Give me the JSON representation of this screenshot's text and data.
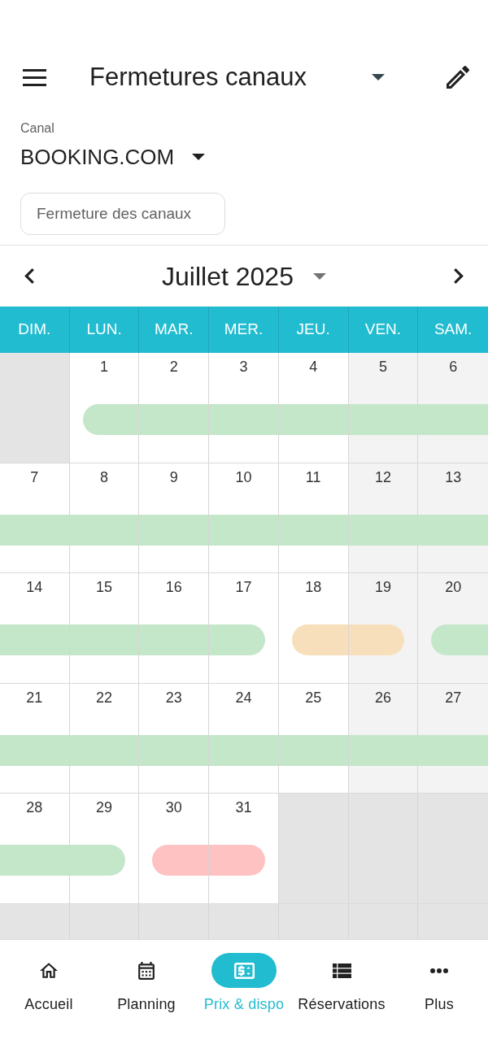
{
  "header": {
    "title": "Fermetures canaux"
  },
  "channel": {
    "label": "Canal",
    "value": "BOOKING.COM"
  },
  "filter_chip": {
    "label": "Fermeture des canaux"
  },
  "month_nav": {
    "title": "Juillet 2025"
  },
  "calendar": {
    "weekdays": [
      "DIM.",
      "LUN.",
      "MAR.",
      "MER.",
      "JEU.",
      "VEN.",
      "SAM."
    ],
    "weeks": [
      {
        "days": [
          {
            "kind": "empty"
          },
          {
            "kind": "day",
            "label": "1",
            "weekend": false,
            "closure": {
              "color": "#c5e7c9",
              "starts": true,
              "ends": false
            }
          },
          {
            "kind": "day",
            "label": "2",
            "weekend": false,
            "closure": {
              "color": "#c5e7c9",
              "starts": false,
              "ends": false
            }
          },
          {
            "kind": "day",
            "label": "3",
            "weekend": false,
            "closure": {
              "color": "#c5e7c9",
              "starts": false,
              "ends": false
            }
          },
          {
            "kind": "day",
            "label": "4",
            "weekend": false,
            "closure": {
              "color": "#c5e7c9",
              "starts": false,
              "ends": false
            }
          },
          {
            "kind": "day",
            "label": "5",
            "weekend": true,
            "closure": {
              "color": "#c5e7c9",
              "starts": false,
              "ends": false
            }
          },
          {
            "kind": "day",
            "label": "6",
            "weekend": true,
            "closure": {
              "color": "#c5e7c9",
              "starts": false,
              "ends": false
            }
          }
        ]
      },
      {
        "days": [
          {
            "kind": "day",
            "label": "7",
            "weekend": false,
            "closure": {
              "color": "#c5e7c9",
              "starts": false,
              "ends": false
            }
          },
          {
            "kind": "day",
            "label": "8",
            "weekend": false,
            "closure": {
              "color": "#c5e7c9",
              "starts": false,
              "ends": false
            }
          },
          {
            "kind": "day",
            "label": "9",
            "weekend": false,
            "closure": {
              "color": "#c5e7c9",
              "starts": false,
              "ends": false
            }
          },
          {
            "kind": "day",
            "label": "10",
            "weekend": false,
            "closure": {
              "color": "#c5e7c9",
              "starts": false,
              "ends": false
            }
          },
          {
            "kind": "day",
            "label": "11",
            "weekend": false,
            "closure": {
              "color": "#c5e7c9",
              "starts": false,
              "ends": false
            }
          },
          {
            "kind": "day",
            "label": "12",
            "weekend": true,
            "closure": {
              "color": "#c5e7c9",
              "starts": false,
              "ends": false
            }
          },
          {
            "kind": "day",
            "label": "13",
            "weekend": true,
            "closure": {
              "color": "#c5e7c9",
              "starts": false,
              "ends": false
            }
          }
        ]
      },
      {
        "days": [
          {
            "kind": "day",
            "label": "14",
            "weekend": false,
            "closure": {
              "color": "#c5e7c9",
              "starts": false,
              "ends": false
            }
          },
          {
            "kind": "day",
            "label": "15",
            "weekend": false,
            "closure": {
              "color": "#c5e7c9",
              "starts": false,
              "ends": false
            }
          },
          {
            "kind": "day",
            "label": "16",
            "weekend": false,
            "closure": {
              "color": "#c5e7c9",
              "starts": false,
              "ends": false
            }
          },
          {
            "kind": "day",
            "label": "17",
            "weekend": false,
            "closure": {
              "color": "#c5e7c9",
              "starts": false,
              "ends": true
            }
          },
          {
            "kind": "day",
            "label": "18",
            "weekend": false,
            "closure": {
              "color": "#f8dfbc",
              "starts": true,
              "ends": false
            }
          },
          {
            "kind": "day",
            "label": "19",
            "weekend": true,
            "closure": {
              "color": "#f8dfbc",
              "starts": false,
              "ends": true
            }
          },
          {
            "kind": "day",
            "label": "20",
            "weekend": true,
            "closure": {
              "color": "#c5e7c9",
              "starts": true,
              "ends": false
            }
          }
        ]
      },
      {
        "days": [
          {
            "kind": "day",
            "label": "21",
            "weekend": false,
            "closure": {
              "color": "#c5e7c9",
              "starts": false,
              "ends": false
            }
          },
          {
            "kind": "day",
            "label": "22",
            "weekend": false,
            "closure": {
              "color": "#c5e7c9",
              "starts": false,
              "ends": false
            }
          },
          {
            "kind": "day",
            "label": "23",
            "weekend": false,
            "closure": {
              "color": "#c5e7c9",
              "starts": false,
              "ends": false
            }
          },
          {
            "kind": "day",
            "label": "24",
            "weekend": false,
            "closure": {
              "color": "#c5e7c9",
              "starts": false,
              "ends": false
            }
          },
          {
            "kind": "day",
            "label": "25",
            "weekend": false,
            "closure": {
              "color": "#c5e7c9",
              "starts": false,
              "ends": false
            }
          },
          {
            "kind": "day",
            "label": "26",
            "weekend": true,
            "closure": {
              "color": "#c5e7c9",
              "starts": false,
              "ends": false
            }
          },
          {
            "kind": "day",
            "label": "27",
            "weekend": true,
            "closure": {
              "color": "#c5e7c9",
              "starts": false,
              "ends": false
            }
          }
        ]
      },
      {
        "days": [
          {
            "kind": "day",
            "label": "28",
            "weekend": false,
            "closure": {
              "color": "#c5e7c9",
              "starts": false,
              "ends": false
            }
          },
          {
            "kind": "day",
            "label": "29",
            "weekend": false,
            "closure": {
              "color": "#c5e7c9",
              "starts": false,
              "ends": true
            }
          },
          {
            "kind": "day",
            "label": "30",
            "weekend": false,
            "closure": {
              "color": "#ffc2c2",
              "starts": true,
              "ends": false
            }
          },
          {
            "kind": "day",
            "label": "31",
            "weekend": false,
            "closure": {
              "color": "#ffc2c2",
              "starts": false,
              "ends": true
            }
          },
          {
            "kind": "empty"
          },
          {
            "kind": "empty"
          },
          {
            "kind": "empty"
          }
        ]
      },
      {
        "days": [
          {
            "kind": "empty"
          },
          {
            "kind": "empty"
          },
          {
            "kind": "empty"
          },
          {
            "kind": "empty"
          },
          {
            "kind": "empty"
          },
          {
            "kind": "empty"
          },
          {
            "kind": "empty"
          }
        ]
      }
    ]
  },
  "bottom_nav": [
    {
      "label": "Accueil",
      "selected": false
    },
    {
      "label": "Planning",
      "selected": false
    },
    {
      "label": "Prix & dispo",
      "selected": true
    },
    {
      "label": "Réservations",
      "selected": false
    },
    {
      "label": "Plus",
      "selected": false
    }
  ]
}
